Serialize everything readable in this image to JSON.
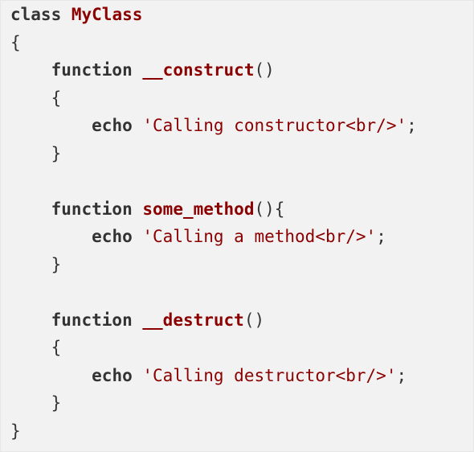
{
  "code_block": {
    "lines": [
      {
        "indent": "",
        "parts": [
          {
            "t": "kw",
            "v": "class"
          },
          {
            "t": "punc",
            "v": " "
          },
          {
            "t": "name",
            "v": "MyClass"
          }
        ]
      },
      {
        "indent": "",
        "parts": [
          {
            "t": "punc",
            "v": "{"
          }
        ]
      },
      {
        "indent": "    ",
        "parts": [
          {
            "t": "kw",
            "v": "function"
          },
          {
            "t": "punc",
            "v": " "
          },
          {
            "t": "name",
            "v": "__construct"
          },
          {
            "t": "punc",
            "v": "()"
          }
        ]
      },
      {
        "indent": "    ",
        "parts": [
          {
            "t": "punc",
            "v": "{"
          }
        ]
      },
      {
        "indent": "        ",
        "parts": [
          {
            "t": "kw",
            "v": "echo"
          },
          {
            "t": "punc",
            "v": " "
          },
          {
            "t": "str",
            "v": "'Calling constructor<br/>'"
          },
          {
            "t": "punc",
            "v": ";"
          }
        ]
      },
      {
        "indent": "    ",
        "parts": [
          {
            "t": "punc",
            "v": "}"
          }
        ]
      },
      {
        "indent": "",
        "parts": []
      },
      {
        "indent": "    ",
        "parts": [
          {
            "t": "kw",
            "v": "function"
          },
          {
            "t": "punc",
            "v": " "
          },
          {
            "t": "name",
            "v": "some_method"
          },
          {
            "t": "punc",
            "v": "(){"
          }
        ]
      },
      {
        "indent": "        ",
        "parts": [
          {
            "t": "kw",
            "v": "echo"
          },
          {
            "t": "punc",
            "v": " "
          },
          {
            "t": "str",
            "v": "'Calling a method<br/>'"
          },
          {
            "t": "punc",
            "v": ";"
          }
        ]
      },
      {
        "indent": "    ",
        "parts": [
          {
            "t": "punc",
            "v": "}"
          }
        ]
      },
      {
        "indent": "",
        "parts": []
      },
      {
        "indent": "    ",
        "parts": [
          {
            "t": "kw",
            "v": "function"
          },
          {
            "t": "punc",
            "v": " "
          },
          {
            "t": "name",
            "v": "__destruct"
          },
          {
            "t": "punc",
            "v": "()"
          }
        ]
      },
      {
        "indent": "    ",
        "parts": [
          {
            "t": "punc",
            "v": "{"
          }
        ]
      },
      {
        "indent": "        ",
        "parts": [
          {
            "t": "kw",
            "v": "echo"
          },
          {
            "t": "punc",
            "v": " "
          },
          {
            "t": "str",
            "v": "'Calling destructor<br/>'"
          },
          {
            "t": "punc",
            "v": ";"
          }
        ]
      },
      {
        "indent": "    ",
        "parts": [
          {
            "t": "punc",
            "v": "}"
          }
        ]
      },
      {
        "indent": "",
        "parts": [
          {
            "t": "punc",
            "v": "}"
          }
        ]
      }
    ]
  }
}
